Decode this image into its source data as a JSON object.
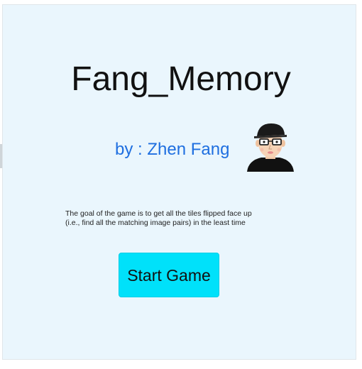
{
  "game": {
    "title": "Fang_Memory",
    "byline": "by : Zhen Fang",
    "description_lines": [
      "The goal of the game is to get all the tiles flipped face up",
      "(i.e., find all the matching image pairs) in the least time"
    ],
    "start_button_label": "Start Game",
    "avatar_icon": "author-avatar-icon"
  },
  "colors": {
    "background": "#eaf6fd",
    "byline": "#1f6fe0",
    "button": "#00e1fa"
  }
}
